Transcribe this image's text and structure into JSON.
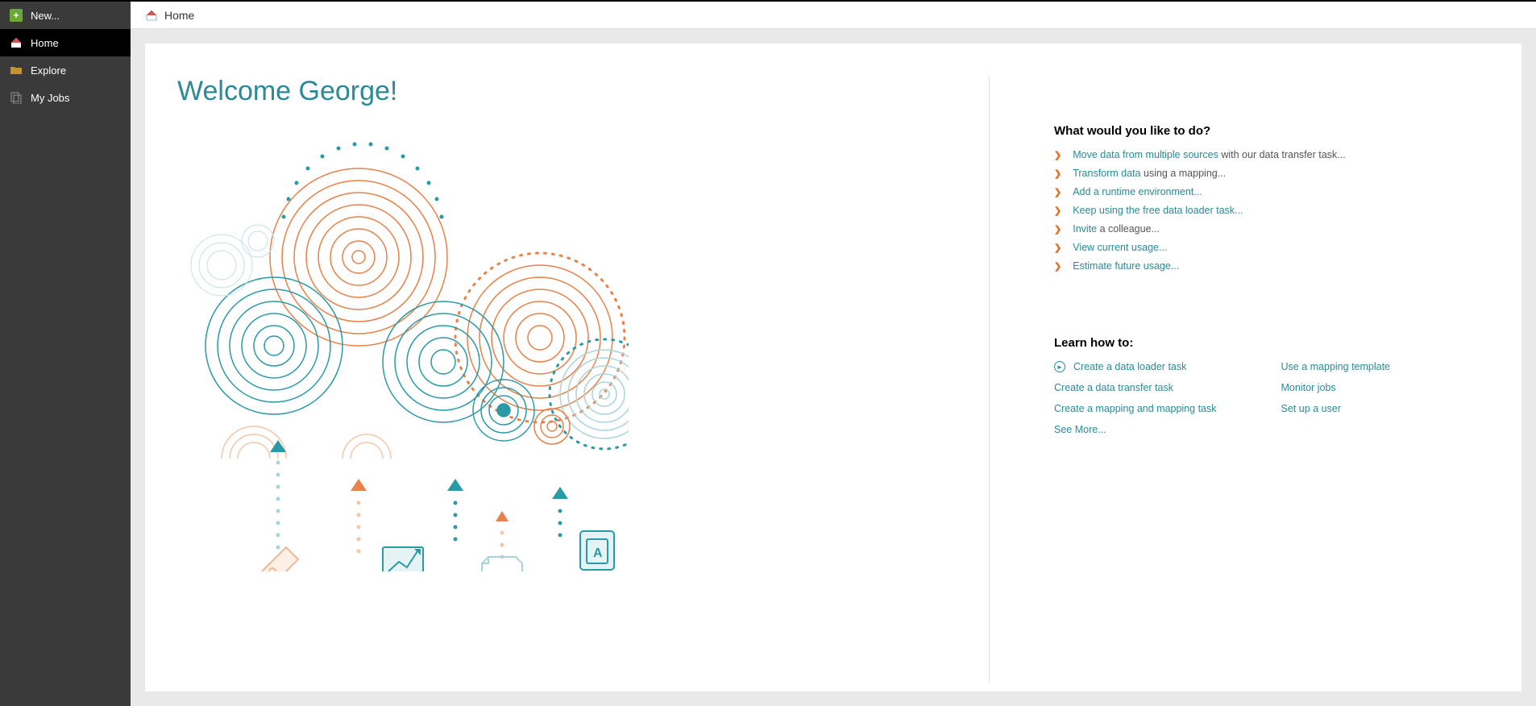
{
  "sidebar": {
    "new_label": "New...",
    "items": [
      {
        "label": "Home"
      },
      {
        "label": "Explore"
      },
      {
        "label": "My Jobs"
      }
    ]
  },
  "breadcrumb": {
    "title": "Home"
  },
  "welcome": "Welcome George!",
  "actions": {
    "heading": "What would you like to do?",
    "items": [
      {
        "link": "Move data from multiple sources",
        "rest": " with our data transfer task..."
      },
      {
        "link": "Transform data",
        "rest": " using a mapping..."
      },
      {
        "link": "Add a runtime environment...",
        "rest": ""
      },
      {
        "link": "Keep using the free data loader task...",
        "rest": ""
      },
      {
        "link": "Invite",
        "rest": " a colleague..."
      },
      {
        "link": "View current usage...",
        "rest": ""
      },
      {
        "link": "Estimate future usage...",
        "rest": ""
      }
    ]
  },
  "learn": {
    "heading": "Learn how to:",
    "col1": [
      "Create a data loader task",
      "Create a data transfer task",
      "Create a mapping and mapping task",
      "See More..."
    ],
    "col2": [
      "Use a mapping template",
      "Monitor jobs",
      "Set up a user"
    ]
  }
}
